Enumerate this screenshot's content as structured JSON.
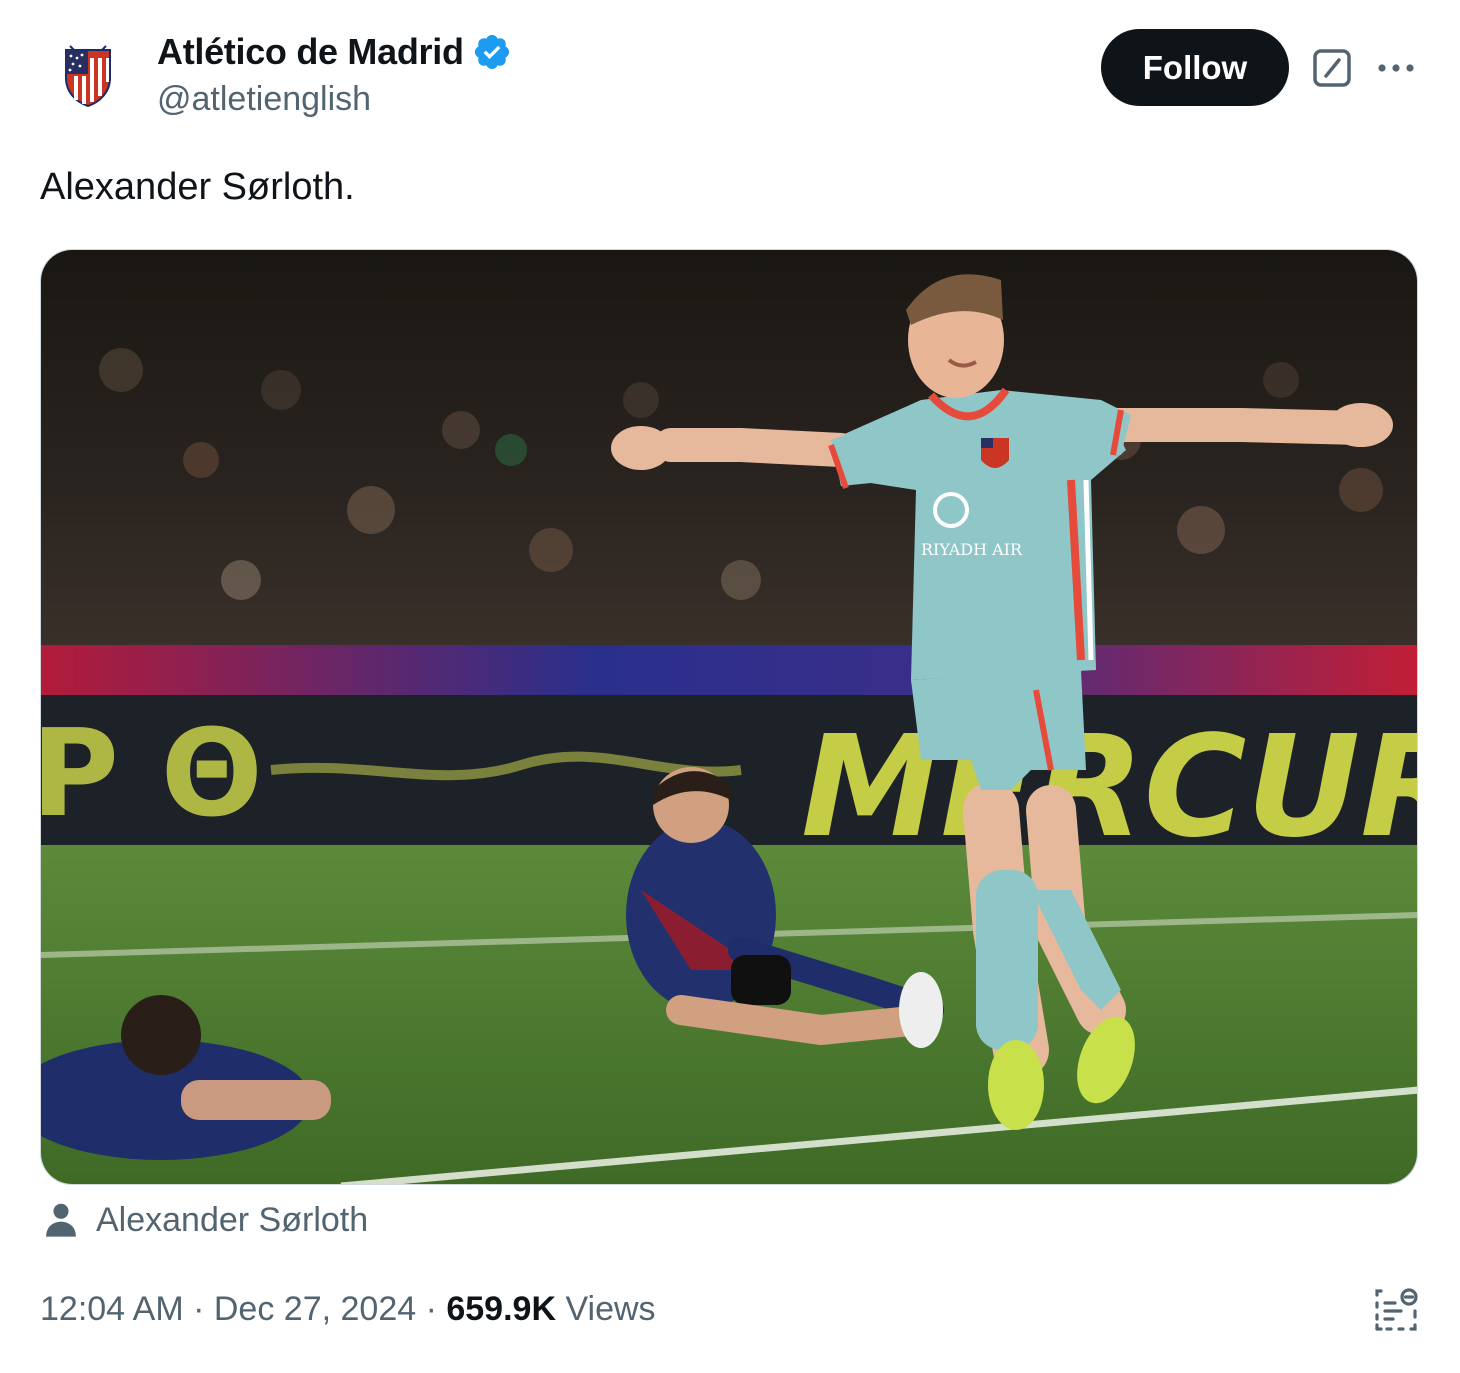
{
  "author": {
    "display_name": "Atlético de Madrid",
    "handle": "@atletienglish",
    "verified": true,
    "avatar_icon": "atletico-crest-icon"
  },
  "actions": {
    "follow_label": "Follow",
    "grok_icon": "grok-icon",
    "more_icon": "more-icon"
  },
  "tweet": {
    "text": "Alexander Sørloth.",
    "media_alt": "Alexander Sørloth celebrating with arms outstretched",
    "tagged_person": "Alexander Sørloth"
  },
  "meta": {
    "time": "12:04 AM",
    "separator": " · ",
    "date": "Dec 27, 2024",
    "views_count": "659.9K",
    "views_label": "Views"
  },
  "colors": {
    "text_primary": "#0f1419",
    "text_secondary": "#536471",
    "verified_blue": "#1d9bf0",
    "follow_bg": "#0f1419",
    "border": "#cfd9de"
  }
}
